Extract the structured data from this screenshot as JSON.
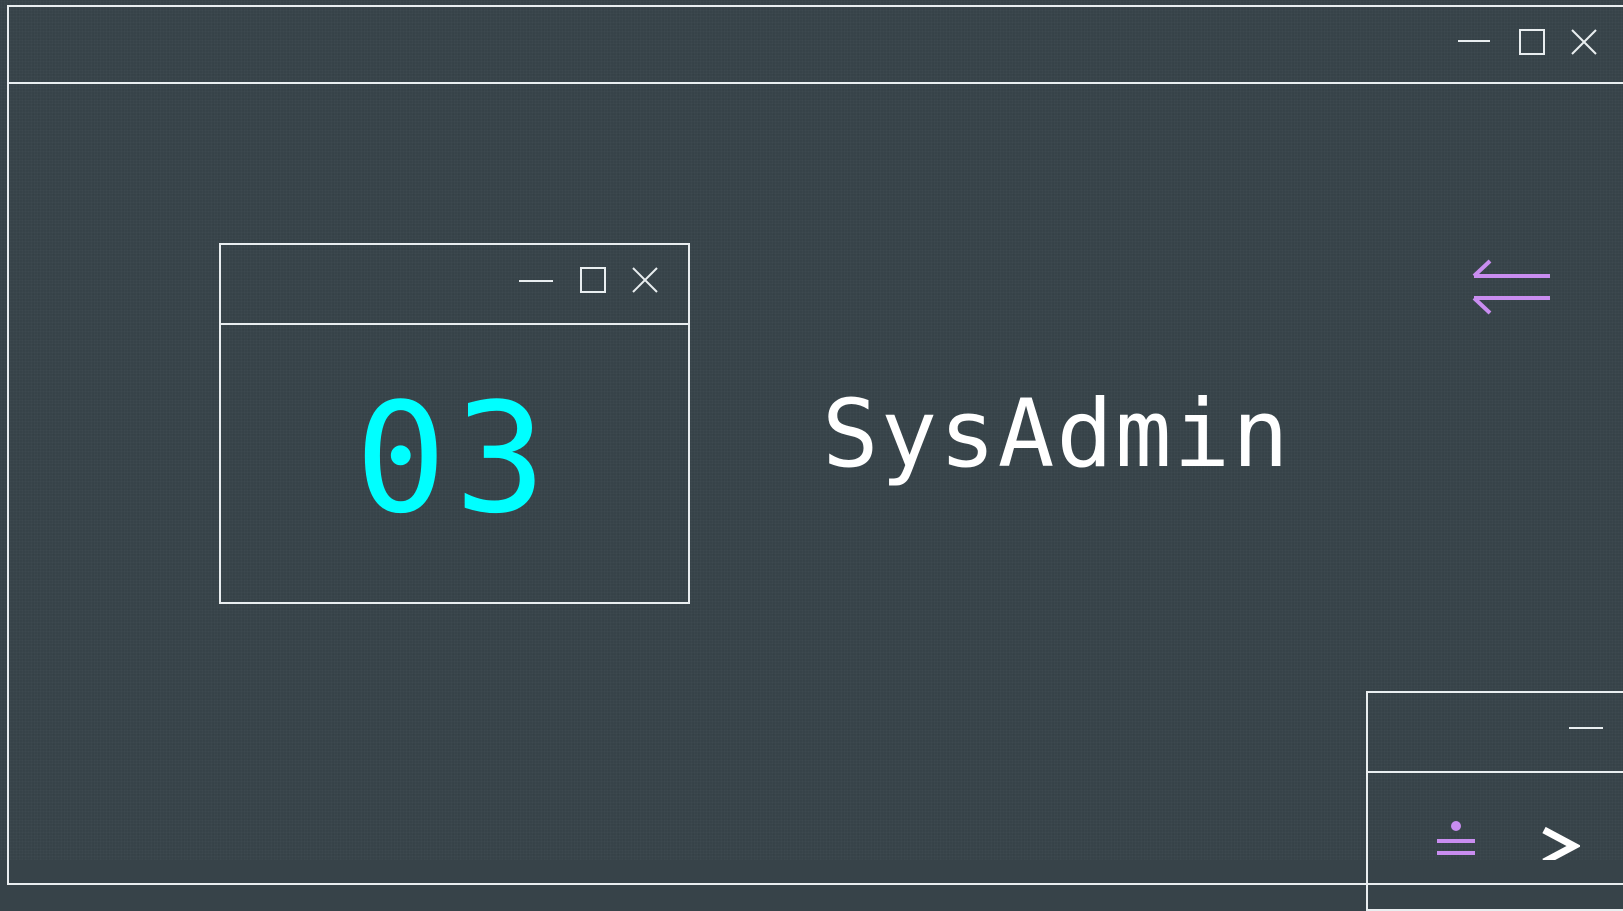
{
  "window": {
    "controls": [
      "minimize-icon",
      "maximize-icon",
      "close-icon"
    ]
  },
  "card": {
    "number": "03",
    "number_color": "#00ffff",
    "controls": [
      "minimize-icon",
      "maximize-icon",
      "close-icon"
    ]
  },
  "title": {
    "text": "SysAdmin",
    "color": "#ffffff"
  },
  "decor": {
    "arrows_icon": "left-right-arrows-icon",
    "arrows_color": "#c98df0"
  },
  "mini_window": {
    "controls": [
      "minimize-icon"
    ],
    "body_icons": [
      "approx-equal-icon",
      "chevron-right-icon"
    ]
  },
  "colors": {
    "background": "#374349",
    "line": "#e9eef0",
    "accent_cyan": "#00ffff",
    "accent_purple": "#c98df0"
  }
}
